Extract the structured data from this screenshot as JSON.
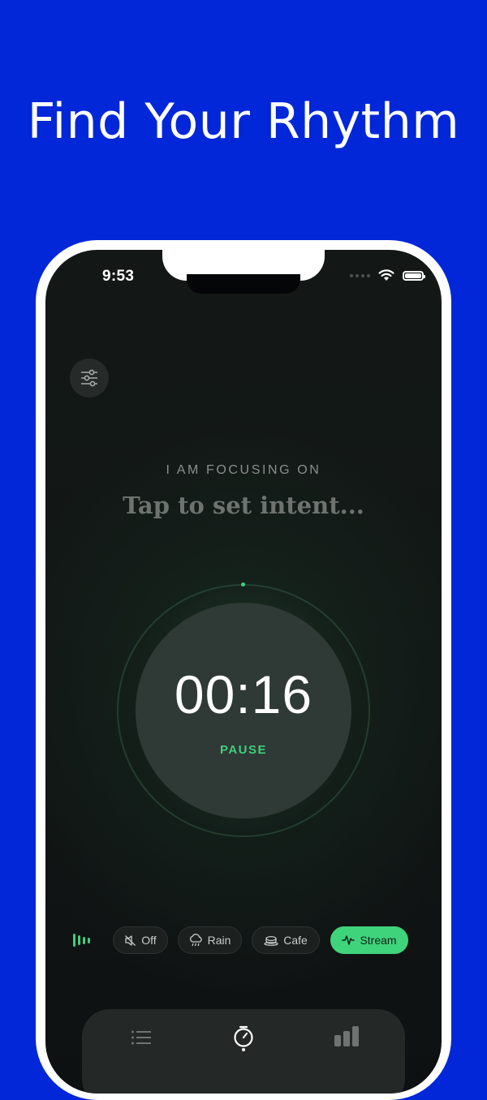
{
  "headline": "Find Your Rhythm",
  "status_bar": {
    "time": "9:53"
  },
  "focus": {
    "label": "I AM FOCUSING ON",
    "intent_placeholder": "Tap to set intent..."
  },
  "timer": {
    "value": "00:16",
    "action_label": "PAUSE",
    "progress": 0.01
  },
  "sounds": {
    "options": [
      {
        "label": "Off",
        "icon": "speaker-muted-icon",
        "active": false
      },
      {
        "label": "Rain",
        "icon": "rain-cloud-icon",
        "active": false
      },
      {
        "label": "Cafe",
        "icon": "coffee-cup-icon",
        "active": false
      },
      {
        "label": "Stream",
        "icon": "pulse-icon",
        "active": true
      }
    ]
  },
  "tabs": [
    {
      "icon": "list-icon"
    },
    {
      "icon": "timer-icon",
      "active": true
    },
    {
      "icon": "bar-chart-icon"
    }
  ],
  "colors": {
    "background": "#0227d8",
    "accent": "#3fd37c",
    "screen": "#121715"
  }
}
